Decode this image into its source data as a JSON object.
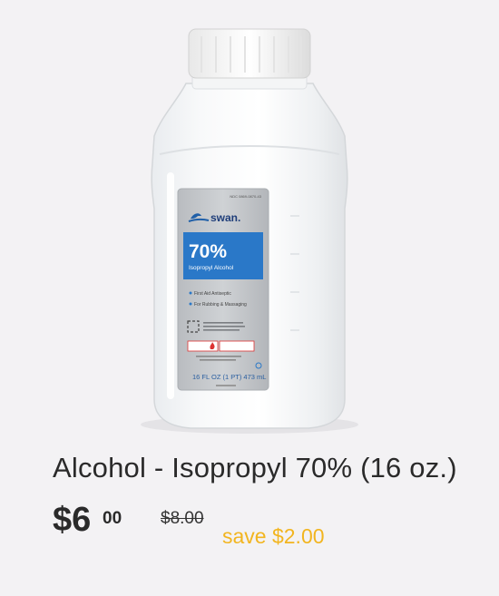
{
  "product": {
    "image_alt": "Swan 70% Isopropyl Alcohol bottle",
    "label": {
      "ndc": "NDC 0869-0870-43",
      "brand": "swan.",
      "percent": "70%",
      "name": "Isopropyl Alcohol",
      "bullet_1": "First Aid Antiseptic",
      "bullet_2": "For Rubbing & Massaging",
      "size": "16 FL OZ (1 PT) 473 mL"
    },
    "title": "Alcohol - Isopropyl 70% (16 oz.)"
  },
  "pricing": {
    "currency_and_dollars": "$6",
    "cents": "00",
    "original": "$8.00",
    "savings": "save $2.00"
  },
  "colors": {
    "background": "#f3f2f4",
    "accent_blue": "#2a78c8",
    "savings_gold": "#f2b51f",
    "text_dark": "#2a2a2a"
  }
}
